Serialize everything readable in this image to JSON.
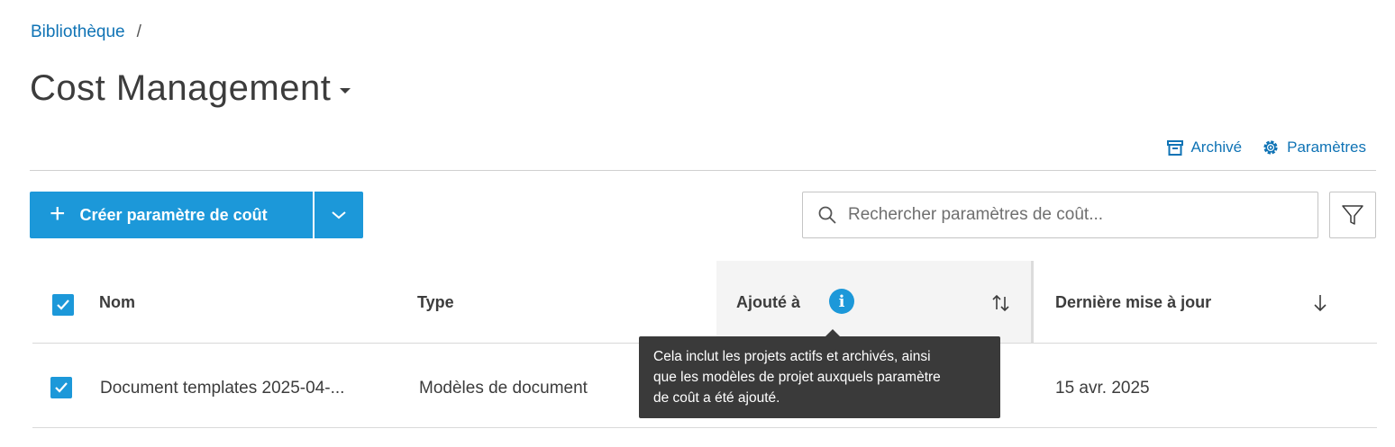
{
  "breadcrumb": {
    "root": "Bibliothèque",
    "separator": "/"
  },
  "page": {
    "title": "Cost Management"
  },
  "top_actions": {
    "archived": "Archivé",
    "settings": "Paramètres"
  },
  "toolbar": {
    "create_label": "Créer paramètre de coût",
    "create_plus": "+",
    "search_placeholder": "Rechercher paramètres de coût..."
  },
  "table": {
    "columns": {
      "name": "Nom",
      "type": "Type",
      "added_to": "Ajouté à",
      "last_updated": "Dernière mise à jour"
    },
    "rows": [
      {
        "name": "Document templates 2025-04-...",
        "type": "Modèles de document",
        "added_to": "",
        "last_updated": "15 avr. 2025",
        "checked": true
      }
    ],
    "all_checked": true
  },
  "tooltip": {
    "line1": "Cela inclut les projets actifs et archivés, ainsi",
    "line2": "que les modèles de projet auxquels paramètre",
    "line3": "de coût a été ajouté."
  },
  "colors": {
    "accent": "#1c98d9",
    "link": "#0f73b5",
    "tooltip_bg": "#3a3a3a",
    "header_highlight": "#f4f4f4"
  },
  "icons": {
    "archive": "archive-icon",
    "settings": "gear-icon",
    "search": "search-icon",
    "filter": "funnel-icon",
    "info": "info-icon",
    "sort_both": "sort-icon",
    "sort_desc": "arrow-down-icon"
  }
}
